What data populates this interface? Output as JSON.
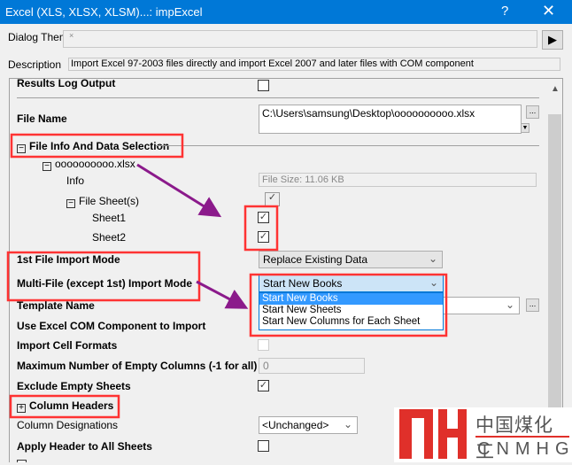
{
  "window": {
    "title": "Excel (XLS, XLSX, XLSM)...: impExcel",
    "help": "?",
    "close": "✕"
  },
  "dialog_theme": {
    "label": "Dialog Theme",
    "value": "×",
    "arrow": "▶"
  },
  "description": {
    "label": "Description",
    "value": "Import Excel 97-2003 files directly and import Excel 2007 and later files with COM component"
  },
  "rows": {
    "results_log": "Results Log Output",
    "file_name": {
      "label": "File Name",
      "value": "C:\\Users\\samsung\\Desktop\\oooooooooo.xlsx",
      "browse": "..."
    },
    "file_info": "File Info And Data Selection",
    "file_node": "oooooooooo.xlsx",
    "info": {
      "label": "Info",
      "value": "File Size: 11.06 KB"
    },
    "file_sheets": "File Sheet(s)",
    "sheet1": {
      "label": "Sheet1",
      "checked": true
    },
    "sheet2": {
      "label": "Sheet2",
      "checked": true
    },
    "first_mode": {
      "label": "1st File Import Mode",
      "value": "Replace Existing Data"
    },
    "multi_mode": {
      "label": "Multi-File (except 1st) Import Mode",
      "value": "Start New Books",
      "options": [
        "Start New Books",
        "Start New Sheets",
        "Start New Columns for Each Sheet"
      ]
    },
    "template": {
      "label": "Template Name",
      "browse": "..."
    },
    "use_com": "Use Excel COM Component to Import",
    "cell_formats": "Import Cell Formats",
    "max_empty": {
      "label": "Maximum Number of Empty Columns (-1 for all)",
      "value": "0"
    },
    "exclude_empty": {
      "label": "Exclude Empty Sheets",
      "checked": true
    },
    "column_headers": "Column Headers",
    "col_designations": {
      "label": "Column Designations",
      "value": "<Unchanged>"
    },
    "apply_header": "Apply Header to All Sheets"
  },
  "watermark": {
    "cn": "中国煤化工",
    "en": "CNMHG"
  },
  "colors": {
    "accent": "#0078d7",
    "highlight": "#ff3333",
    "arrow": "#8b1a8b"
  }
}
